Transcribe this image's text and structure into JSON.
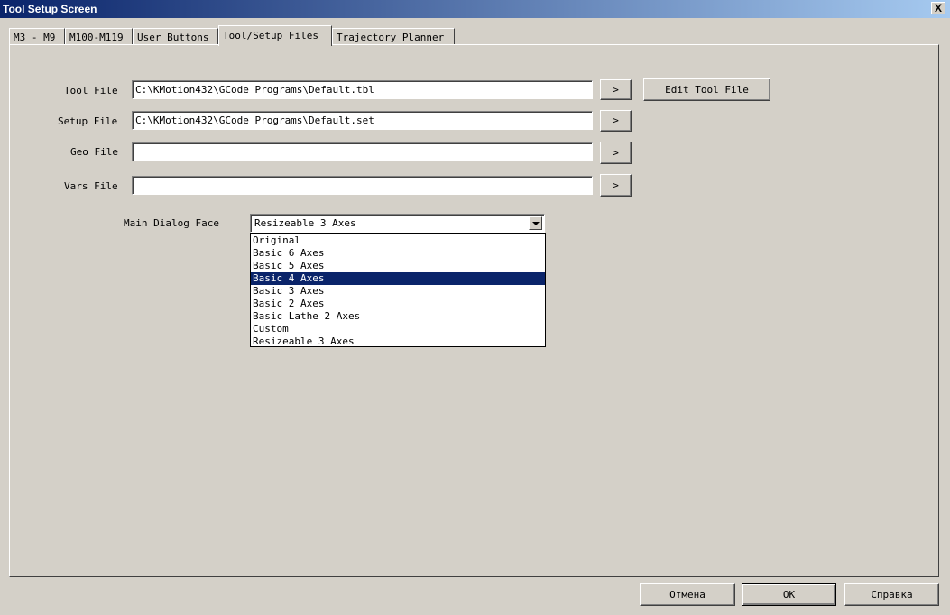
{
  "window": {
    "title": "Tool Setup Screen",
    "close_glyph": "X"
  },
  "tabs": [
    {
      "label": "M3 - M9"
    },
    {
      "label": "M100-M119"
    },
    {
      "label": "User Buttons"
    },
    {
      "label": "Tool/Setup Files",
      "active": true
    },
    {
      "label": "Trajectory Planner"
    }
  ],
  "files": {
    "tool": {
      "label": "Tool File",
      "value": "C:\\KMotion432\\GCode Programs\\Default.tbl"
    },
    "setup": {
      "label": "Setup File",
      "value": "C:\\KMotion432\\GCode Programs\\Default.set"
    },
    "geo": {
      "label": "Geo File",
      "value": ""
    },
    "vars": {
      "label": "Vars File",
      "value": ""
    },
    "browse_label": ">",
    "edit_tool_label": "Edit Tool File"
  },
  "dialog_face": {
    "label": "Main Dialog Face",
    "selected": "Resizeable 3 Axes",
    "options": [
      "Original",
      "Basic 6 Axes",
      "Basic 5 Axes",
      "Basic 4 Axes",
      "Basic 3 Axes",
      "Basic 2 Axes",
      "Basic Lathe 2 Axes",
      "Custom",
      "Resizeable 3 Axes"
    ],
    "highlighted": "Basic 4 Axes"
  },
  "footer": {
    "cancel_label": "Отмена",
    "ok_label": "OK",
    "help_label": "Справка"
  }
}
